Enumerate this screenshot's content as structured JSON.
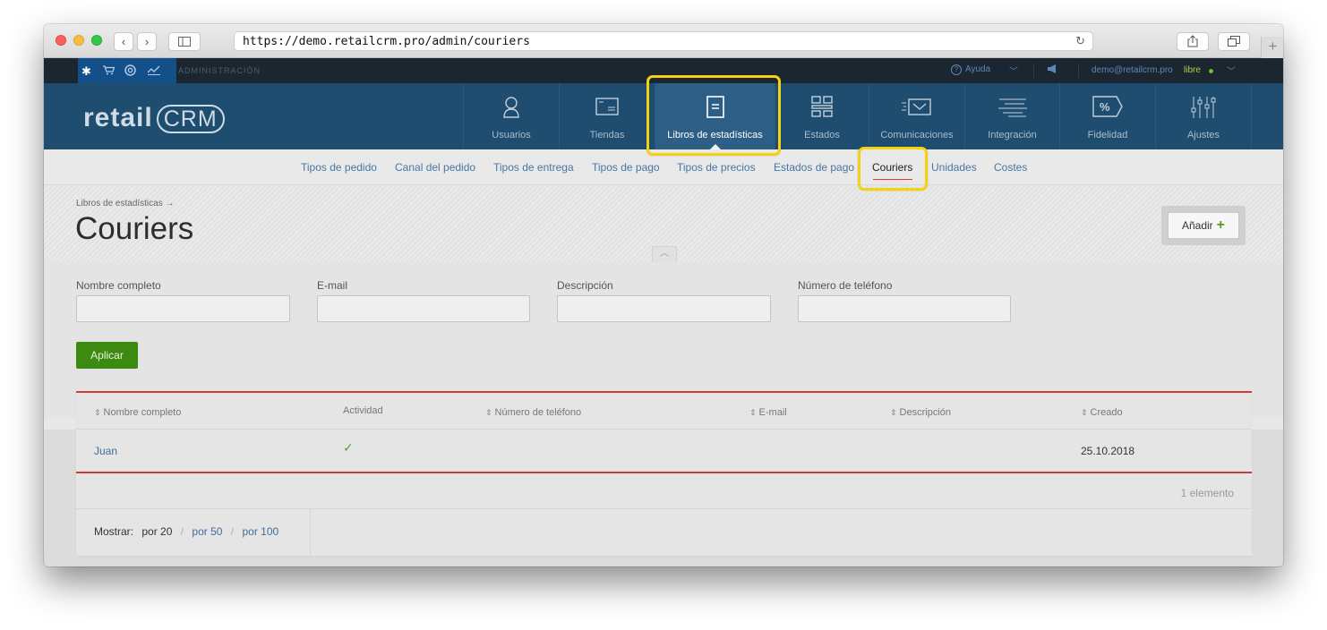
{
  "browser": {
    "url": "https://demo.retailcrm.pro/admin/couriers",
    "back": "‹",
    "forward": "›",
    "reload": "↻",
    "new_tab": "+"
  },
  "adminbar": {
    "section": "ADMINISTRACIÓN",
    "help": "Ayuda",
    "email": "demo@retailcrm.pro",
    "plan": "libre"
  },
  "logo": {
    "text": "retail",
    "brand": "CRM"
  },
  "mainnav": [
    {
      "label": "Usuarios",
      "icon": "user-icon"
    },
    {
      "label": "Tiendas",
      "icon": "store-icon"
    },
    {
      "label": "Libros de estadísticas",
      "icon": "book-icon",
      "active": true
    },
    {
      "label": "Estados",
      "icon": "grid-icon"
    },
    {
      "label": "Comunicaciones",
      "icon": "mail-icon"
    },
    {
      "label": "Integración",
      "icon": "integration-icon"
    },
    {
      "label": "Fidelidad",
      "icon": "percent-tag-icon"
    },
    {
      "label": "Ajustes",
      "icon": "sliders-icon"
    }
  ],
  "subnav": [
    "Tipos de pedido",
    "Canal del pedido",
    "Tipos de entrega",
    "Tipos de pago",
    "Tipos de precios",
    "Estados de pago",
    "Couriers",
    "Unidades",
    "Costes"
  ],
  "page": {
    "breadcrumb": "Libros de estadísticas →",
    "title": "Couriers",
    "add_label": "Añadir",
    "add_plus": "+"
  },
  "filters": {
    "fields": [
      "Nombre completo",
      "E-mail",
      "Descripción",
      "Número de teléfono"
    ],
    "apply": "Aplicar"
  },
  "table": {
    "sort_glyph": "⇕",
    "columns": [
      "Nombre completo",
      "Actividad",
      "Número de teléfono",
      "E-mail",
      "Descripción",
      "Creado"
    ],
    "rows": [
      {
        "name": "Juan",
        "active": "✓",
        "phone": "",
        "email": "",
        "description": "",
        "created": "25.10.2018"
      }
    ],
    "count": "1 elemento",
    "pager": {
      "label": "Mostrar:",
      "current": "por 20",
      "options": [
        "por 50",
        "por 100"
      ],
      "separator": "/"
    }
  },
  "colors": {
    "accent_nav": "#1f4d70",
    "highlight": "#f6d10f",
    "apply_green": "#3c8a0f",
    "link": "#4677a3"
  }
}
